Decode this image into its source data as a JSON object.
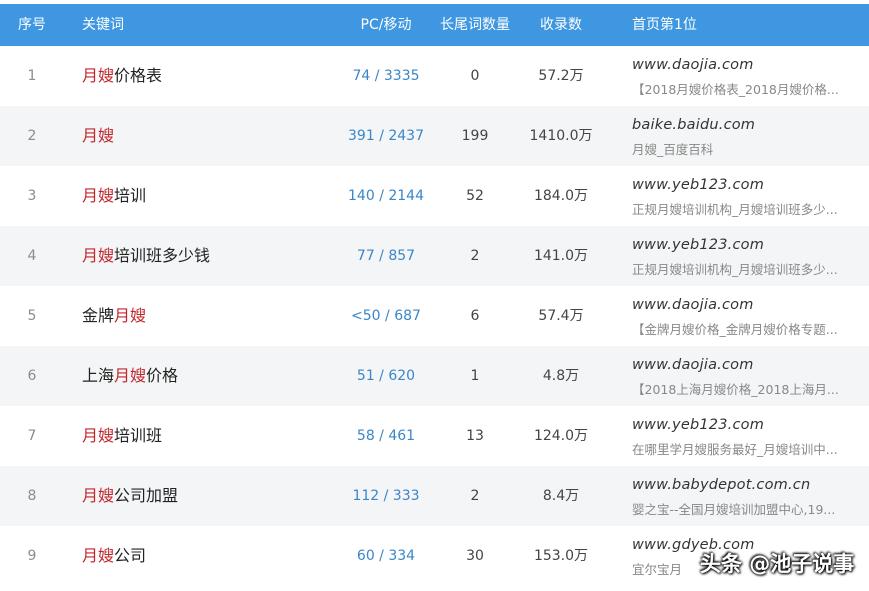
{
  "header": {
    "col_index": "序号",
    "col_keyword": "关键词",
    "col_pc_mobile": "PC/移动",
    "col_longtail": "长尾词数量",
    "col_indexed": "收录数",
    "col_top1": "首页第1位"
  },
  "rows": [
    {
      "index": "1",
      "kw_pre": "",
      "kw_hl": "月嫂",
      "kw_post": "价格表",
      "pc_mobile": "74 / 3335",
      "longtail": "0",
      "indexed": "57.2万",
      "top_domain": "www.daojia.com",
      "top_snippet": "【2018月嫂价格表_2018月嫂价格..."
    },
    {
      "index": "2",
      "kw_pre": "",
      "kw_hl": "月嫂",
      "kw_post": "",
      "pc_mobile": "391 / 2437",
      "longtail": "199",
      "indexed": "1410.0万",
      "top_domain": "baike.baidu.com",
      "top_snippet": "月嫂_百度百科"
    },
    {
      "index": "3",
      "kw_pre": "",
      "kw_hl": "月嫂",
      "kw_post": "培训",
      "pc_mobile": "140 / 2144",
      "longtail": "52",
      "indexed": "184.0万",
      "top_domain": "www.yeb123.com",
      "top_snippet": "正规月嫂培训机构_月嫂培训班多少..."
    },
    {
      "index": "4",
      "kw_pre": "",
      "kw_hl": "月嫂",
      "kw_post": "培训班多少钱",
      "pc_mobile": "77 / 857",
      "longtail": "2",
      "indexed": "141.0万",
      "top_domain": "www.yeb123.com",
      "top_snippet": "正规月嫂培训机构_月嫂培训班多少..."
    },
    {
      "index": "5",
      "kw_pre": "金牌",
      "kw_hl": "月嫂",
      "kw_post": "",
      "pc_mobile": "<50 / 687",
      "longtail": "6",
      "indexed": "57.4万",
      "top_domain": "www.daojia.com",
      "top_snippet": "【金牌月嫂价格_金牌月嫂价格专题..."
    },
    {
      "index": "6",
      "kw_pre": "上海",
      "kw_hl": "月嫂",
      "kw_post": "价格",
      "pc_mobile": "51 / 620",
      "longtail": "1",
      "indexed": "4.8万",
      "top_domain": "www.daojia.com",
      "top_snippet": "【2018上海月嫂价格_2018上海月..."
    },
    {
      "index": "7",
      "kw_pre": "",
      "kw_hl": "月嫂",
      "kw_post": "培训班",
      "pc_mobile": "58 / 461",
      "longtail": "13",
      "indexed": "124.0万",
      "top_domain": "www.yeb123.com",
      "top_snippet": "在哪里学月嫂服务最好_月嫂培训中..."
    },
    {
      "index": "8",
      "kw_pre": "",
      "kw_hl": "月嫂",
      "kw_post": "公司加盟",
      "pc_mobile": "112 / 333",
      "longtail": "2",
      "indexed": "8.4万",
      "top_domain": "www.babydepot.com.cn",
      "top_snippet": "婴之宝--全国月嫂培训加盟中心,19..."
    },
    {
      "index": "9",
      "kw_pre": "",
      "kw_hl": "月嫂",
      "kw_post": "公司",
      "pc_mobile": "60 / 334",
      "longtail": "30",
      "indexed": "153.0万",
      "top_domain": "www.gdyeb.com",
      "top_snippet": "宜尔宝月"
    }
  ],
  "watermark": "头条 @池子说事",
  "colors": {
    "header_bg": "#3e97e0",
    "keyword_highlight": "#c0272d",
    "link_blue": "#3a86c8",
    "row_alt": "#f4f5f6"
  }
}
